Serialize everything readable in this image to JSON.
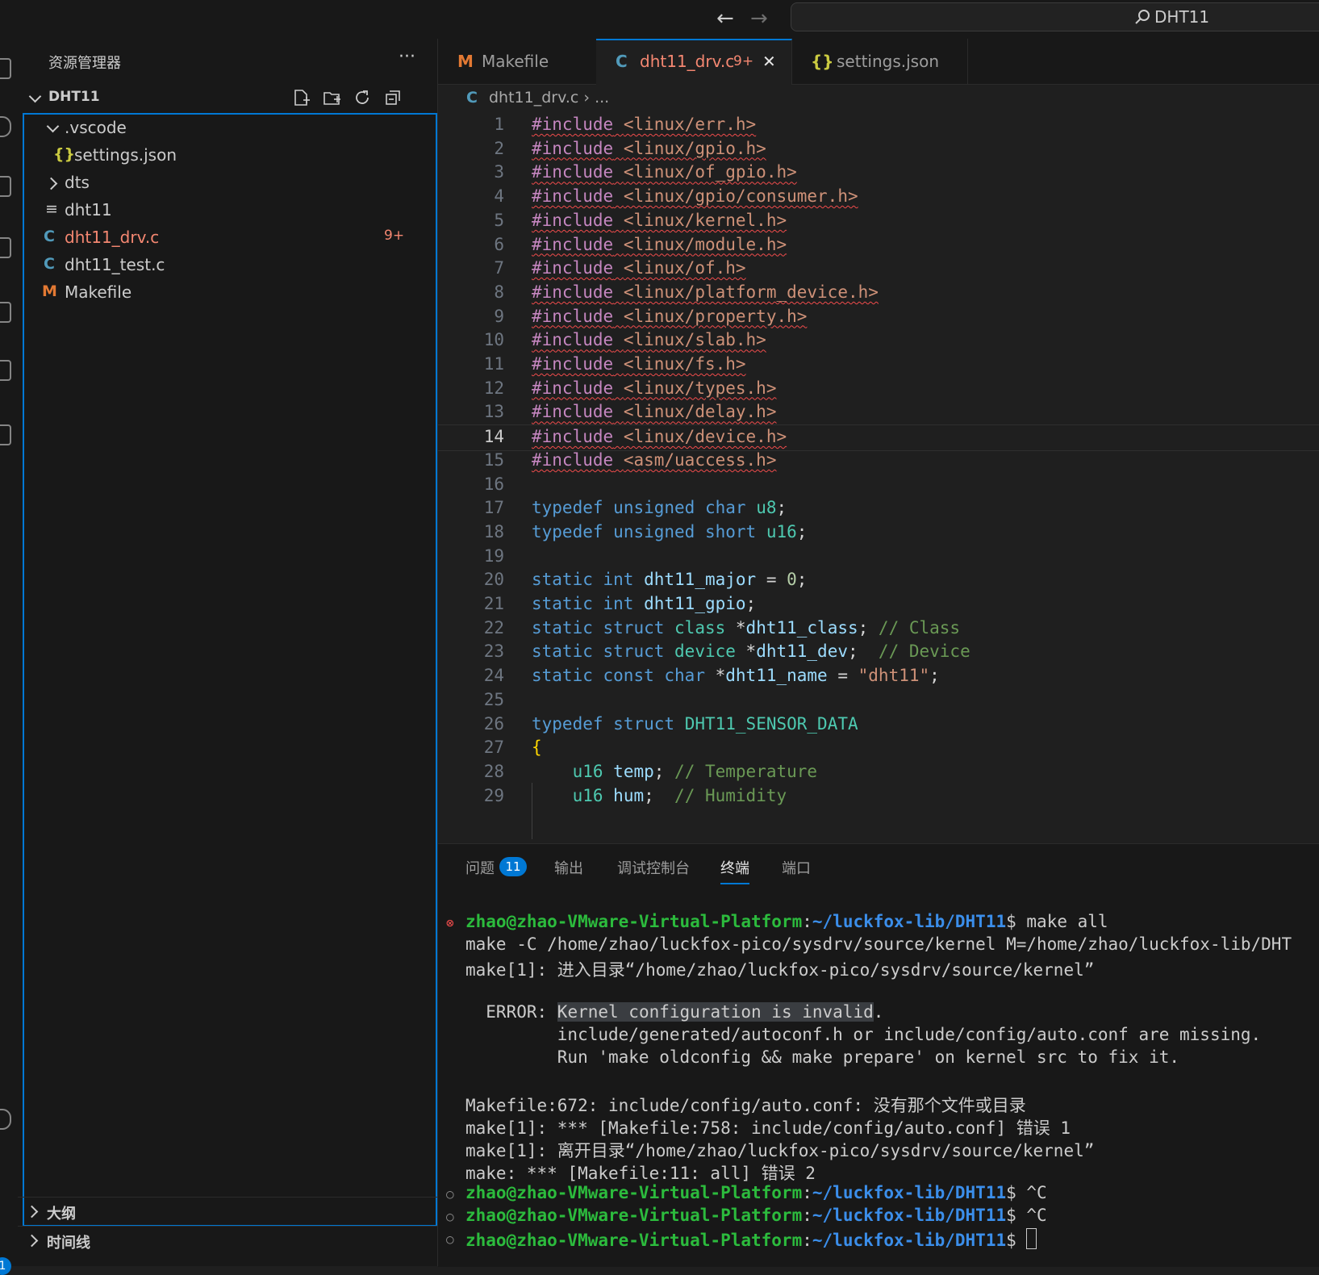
{
  "titlebar": {
    "back": "←",
    "forward": "→",
    "search_text": "DHT11"
  },
  "sidebar": {
    "title": "资源管理器",
    "more": "···",
    "root": "DHT11",
    "items": [
      {
        "label": ".vscode",
        "icon": "chevron-down-icon"
      },
      {
        "label": "settings.json",
        "icon": "json-icon",
        "glyph": "{}"
      },
      {
        "label": "dts",
        "icon": "chevron-right-icon"
      },
      {
        "label": "dht11",
        "icon": "file-lines-icon",
        "glyph": "≡"
      },
      {
        "label": "dht11_drv.c",
        "icon": "c-file-icon",
        "glyph": "C",
        "badge": "9+",
        "color": "#f48771"
      },
      {
        "label": "dht11_test.c",
        "icon": "c-file-icon",
        "glyph": "C"
      },
      {
        "label": "Makefile",
        "icon": "makefile-icon",
        "glyph": "M"
      }
    ],
    "outline": "大纲",
    "timeline": "时间线"
  },
  "tabs": [
    {
      "label": "Makefile",
      "glyph": "M"
    },
    {
      "label": "dht11_drv.c",
      "glyph": "C",
      "badge": "9+",
      "close": "✕"
    },
    {
      "label": "settings.json",
      "glyph": "{}"
    }
  ],
  "breadcrumb": {
    "file": "dht11_drv.c",
    "sep": "›",
    "rest": "..."
  },
  "editor": {
    "current_line": 14,
    "includes": [
      "<linux/err.h>",
      "<linux/gpio.h>",
      "<linux/of_gpio.h>",
      "<linux/gpio/consumer.h>",
      "<linux/kernel.h>",
      "<linux/module.h>",
      "<linux/of.h>",
      "<linux/platform_device.h>",
      "<linux/property.h>",
      "<linux/slab.h>",
      "<linux/fs.h>",
      "<linux/types.h>",
      "<linux/delay.h>",
      "<linux/device.h>",
      "<asm/uaccess.h>"
    ],
    "directive": "#include",
    "line_numbers": [
      "1",
      "2",
      "3",
      "4",
      "5",
      "6",
      "7",
      "8",
      "9",
      "10",
      "11",
      "12",
      "13",
      "14",
      "15",
      "16",
      "17",
      "18",
      "19",
      "20",
      "21",
      "22",
      "23",
      "24",
      "25",
      "26",
      "27",
      "28",
      "29"
    ]
  },
  "panel": {
    "tabs": [
      "问题",
      "输出",
      "调试控制台",
      "终端",
      "端口"
    ],
    "problems_count": "11",
    "active_tab": "终端",
    "prompt_user": "zhao@zhao-VMware-Virtual-Platform",
    "prompt_path": "~/luckfox-lib/DHT11",
    "terminal": [
      "make -C /home/zhao/luckfox-pico/sysdrv/source/kernel M=/home/zhao/luckfox-lib/DHT",
      "make[1]: 进入目录“/home/zhao/luckfox-pico/sysdrv/source/kernel”",
      "",
      "  ERROR: ",
      "Kernel configuration is invalid",
      ".",
      "         include/generated/autoconf.h or include/config/auto.conf are missing.",
      "         Run 'make oldconfig && make prepare' on kernel src to fix it.",
      "",
      "Makefile:672: include/config/auto.conf: 没有那个文件或目录",
      "make[1]: *** [Makefile:758: include/config/auto.conf] 错误 1",
      "make[1]: 离开目录“/home/zhao/luckfox-pico/sysdrv/source/kernel”",
      "make: *** [Makefile:11: all] 错误 2"
    ],
    "commands": [
      "make all",
      "^C",
      "^C",
      ""
    ]
  }
}
